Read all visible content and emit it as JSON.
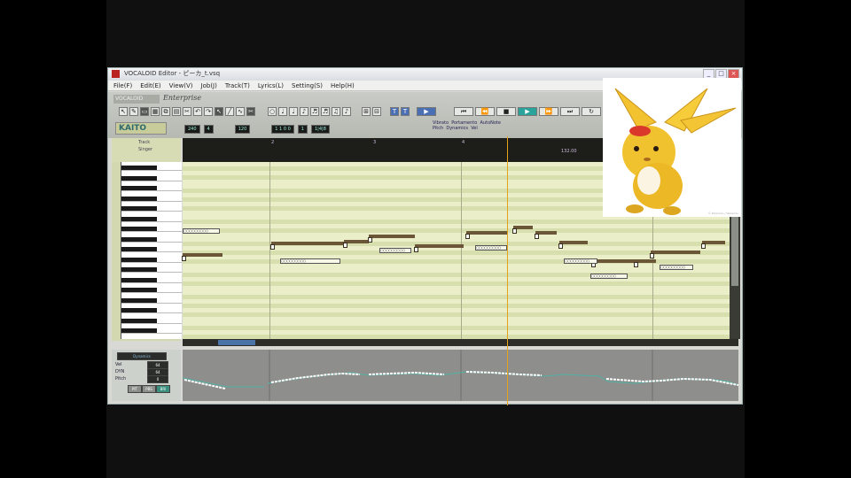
{
  "window": {
    "title": "VOCALOID Editor - ピーカ_t.vsq",
    "buttons": [
      "_",
      "□",
      "×"
    ]
  },
  "menu": [
    "File(F)",
    "Edit(E)",
    "View(V)",
    "Job(J)",
    "Track(T)",
    "Lyrics(L)",
    "Setting(S)",
    "Help(H)"
  ],
  "toolbar": {
    "product_logo": "VOCALOID",
    "edition_logo": "Enterprise",
    "singer_name": "KAITO",
    "lcd_values": [
      "240",
      "4",
      "120",
      "1 1 0 0",
      "1",
      "1|4|8"
    ],
    "option_labels": [
      "Vibrato",
      "Portamento",
      "AutoNote",
      "Pitch",
      "Dynamics",
      "Vel"
    ]
  },
  "ruler": {
    "marks": [
      "2",
      "3",
      "4",
      "5"
    ],
    "tempo": "132.00"
  },
  "left_panel": {
    "header_lines": [
      "Track",
      "Singer"
    ]
  },
  "control_panel": {
    "param_label": "Dynamics",
    "value_labels": [
      "Vel",
      "DYN",
      "Pitch"
    ],
    "values": [
      "64",
      "64",
      "0"
    ],
    "buttons": [
      "PIT",
      "PBS",
      "BRI"
    ]
  },
  "picture": {
    "credit": "© Pokemon / Nintendo"
  },
  "colors": {
    "accent": "#e5a21a",
    "roll_background": "#e8ecc8",
    "note": "#6b5637",
    "singer_badge": "#c8cc9a"
  }
}
